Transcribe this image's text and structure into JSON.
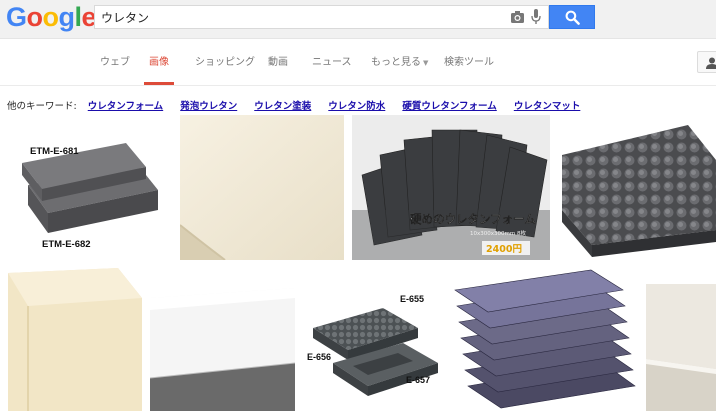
{
  "header": {
    "logo_text": "Google",
    "logo_letters": [
      {
        "ch": "G",
        "color": "#4285f4"
      },
      {
        "ch": "o",
        "color": "#ea4335"
      },
      {
        "ch": "o",
        "color": "#fbbc05"
      },
      {
        "ch": "g",
        "color": "#4285f4"
      },
      {
        "ch": "l",
        "color": "#34a853"
      },
      {
        "ch": "e",
        "color": "#ea4335"
      }
    ],
    "search_query": "ウレタン",
    "icons": {
      "camera": "camera-icon",
      "mic": "microphone-icon",
      "search": "search-icon",
      "account": "account-icon"
    }
  },
  "tabs": [
    {
      "label": "ウェブ",
      "active": false
    },
    {
      "label": "画像",
      "active": true
    },
    {
      "label": "ショッピング",
      "active": false
    },
    {
      "label": "動画",
      "active": false
    },
    {
      "label": "ニュース",
      "active": false
    },
    {
      "label": "もっと見る",
      "active": false
    },
    {
      "label": "検索ツール",
      "active": false
    }
  ],
  "related": {
    "label": "他のキーワード:",
    "links": [
      "ウレタンフォーム",
      "発泡ウレタン",
      "ウレタン塗装",
      "ウレタン防水",
      "硬質ウレタンフォーム",
      "ウレタンマット"
    ]
  },
  "images": {
    "tile1": {
      "labels": [
        "ETM-E-681",
        "ETM-E-682"
      ]
    },
    "tile3": {
      "caption": "硬めのウレタンフォーム",
      "sub": "10x300x300mm 8枚",
      "price": "2400円"
    },
    "tile7": {
      "labels": [
        "E-655",
        "E-656",
        "E-657"
      ]
    }
  },
  "colors": {
    "accent_tab": "#dd4b39",
    "link": "#1a0dab",
    "search_button": "#4285f4"
  }
}
